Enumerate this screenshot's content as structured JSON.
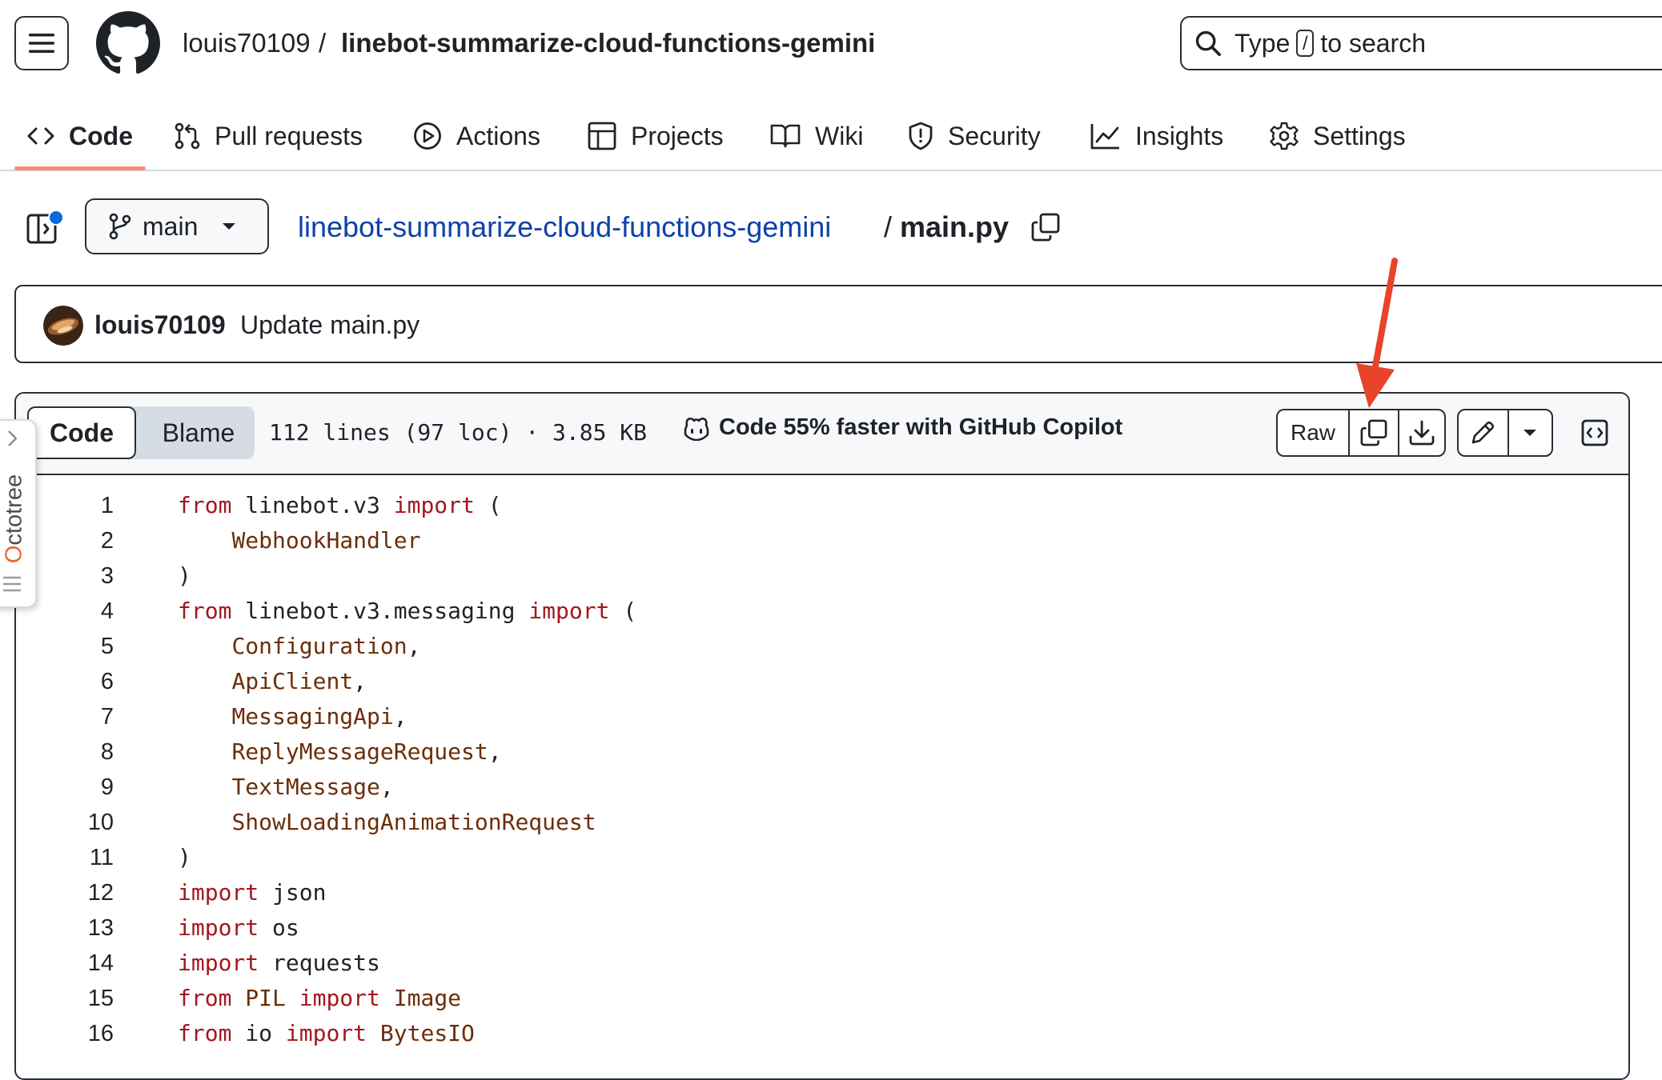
{
  "header": {
    "owner": "louis70109",
    "separator": "/",
    "repo": "linebot-summarize-cloud-functions-gemini",
    "search_prefix": "Type",
    "search_key": "/",
    "search_suffix": "to search"
  },
  "nav": {
    "items": [
      {
        "label": "Code",
        "icon": "code-icon",
        "active": true
      },
      {
        "label": "Pull requests",
        "icon": "pull-request-icon"
      },
      {
        "label": "Actions",
        "icon": "play-icon"
      },
      {
        "label": "Projects",
        "icon": "table-icon"
      },
      {
        "label": "Wiki",
        "icon": "book-icon"
      },
      {
        "label": "Security",
        "icon": "shield-icon"
      },
      {
        "label": "Insights",
        "icon": "graph-icon"
      },
      {
        "label": "Settings",
        "icon": "gear-icon"
      }
    ]
  },
  "file": {
    "branch": "main",
    "repo_link": "linebot-summarize-cloud-functions-gemini",
    "path_separator": "/",
    "filename": "main.py"
  },
  "commit": {
    "author": "louis70109",
    "message": "Update main.py"
  },
  "viewer": {
    "tab_code": "Code",
    "tab_blame": "Blame",
    "file_info": "112 lines (97 loc) · 3.85 KB",
    "copilot_text": "Code 55% faster with GitHub Copilot",
    "raw_label": "Raw"
  },
  "code_lines": [
    {
      "n": "1",
      "a": "from",
      "b": " linebot.v3 ",
      "c": "import",
      "d": " ("
    },
    {
      "n": "2",
      "i": "    ",
      "name": "WebhookHandler"
    },
    {
      "n": "3",
      "plain": ")"
    },
    {
      "n": "4",
      "a": "from",
      "b": " linebot.v3.messaging ",
      "c": "import",
      "d": " ("
    },
    {
      "n": "5",
      "i": "    ",
      "name": "Configuration",
      "t": ","
    },
    {
      "n": "6",
      "i": "    ",
      "name": "ApiClient",
      "t": ","
    },
    {
      "n": "7",
      "i": "    ",
      "name": "MessagingApi",
      "t": ","
    },
    {
      "n": "8",
      "i": "    ",
      "name": "ReplyMessageRequest",
      "t": ","
    },
    {
      "n": "9",
      "i": "    ",
      "name": "TextMessage",
      "t": ","
    },
    {
      "n": "10",
      "i": "    ",
      "name": "ShowLoadingAnimationRequest"
    },
    {
      "n": "11",
      "plain": ")"
    },
    {
      "n": "12",
      "a": "import",
      "b": " json"
    },
    {
      "n": "13",
      "a": "import",
      "b": " os"
    },
    {
      "n": "14",
      "a": "import",
      "b": " requests"
    },
    {
      "n": "15",
      "a": "from",
      "b": " ",
      "name2": "PIL",
      "b2": " ",
      "c": "import",
      "d": " ",
      "name3": "Image"
    },
    {
      "n": "16",
      "a": "from",
      "b": " io ",
      "c": "import",
      "d": " ",
      "name3": "BytesIO"
    }
  ],
  "octotree": {
    "label_first": "O",
    "label_rest": "ctotree"
  },
  "colors": {
    "accent": "#fd8c73",
    "link": "#0d42a8",
    "keyword": "#a3171f",
    "name": "#6b2e08",
    "arrow": "#e8432b"
  }
}
